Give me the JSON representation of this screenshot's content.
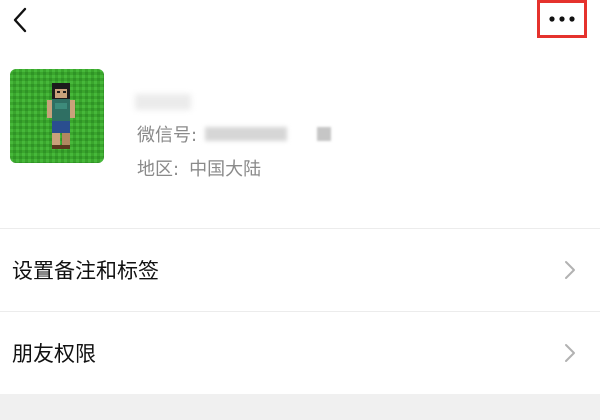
{
  "colors": {
    "accent_red": "#e5322d",
    "text_primary": "#111111",
    "text_secondary": "#8a8a8a",
    "avatar_green": "#3aa52d",
    "divider": "#ececec",
    "background_band": "#f0f0f0"
  },
  "topbar": {
    "back_icon": "chevron-left-icon",
    "more_icon": "ellipsis-icon"
  },
  "profile": {
    "wechat_id_label": "微信号:",
    "region_label": "地区:",
    "region_value": "中国大陆"
  },
  "menu": {
    "items": [
      {
        "label": "设置备注和标签",
        "icon": "chevron-right-icon"
      },
      {
        "label": "朋友权限",
        "icon": "chevron-right-icon"
      }
    ]
  }
}
